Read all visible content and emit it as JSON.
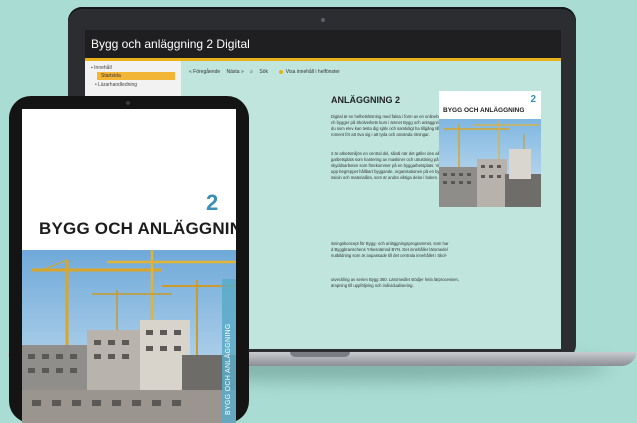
{
  "app": {
    "title": "Bygg och anläggning 2 Digital"
  },
  "sidebar": {
    "items": [
      {
        "label": "Innehåll"
      },
      {
        "label": "Startsida"
      },
      {
        "label": "• Lärarhandledning"
      }
    ]
  },
  "nav": {
    "prev": "« Föregående",
    "next": "Nästa »",
    "search": "Sök",
    "toc": "Visa innehåll i helfönster"
  },
  "document": {
    "title": "ANLÄGGNING 2",
    "paragraphs": [
      "Digital är en helhetslösning med fakta i form av en onlinebok\nch bygger på Skolverkets kurs i ämnet Bygg och anläggning.\ndu som elev kan testa dig själv och samtidigt ha tillgång till fakta från boken.\nroment för att öva sig i att tyda och använda ritningar.",
      "2 är arbetsmiljön en central del, såväl när det gäller den allmänna\ngarbetsplats som hantering av maskiner och utrustning på att\nskyddsarbeten som förekommer på en byggarbetsplats. Vidare tar\nupp begreppet hållbart byggande, organisationen på en bygg-\nssioin och materialåra, som är andra viktiga delar i boken.",
      "isningskoncept för Bygg- och anläggningsprogrammet, som har\nd Byggbranschens Yrkesnämnd BYN. Det innehåller läromedel\nnutbildning som är anpassade till det centrala innehållet i Skol-",
      "utveckling av serien Bygg 360. Läromedlet stödjer hela lärprocessen,\nämpning till uppföljning och individualisering."
    ]
  },
  "cover_small": {
    "number": "2",
    "title": "BYGG OCH ANLÄGGNING"
  },
  "tablet": {
    "number": "2",
    "title": "BYGG OCH ANLÄGGNING",
    "spine": "BYGG OCH ANLÄGGNING"
  },
  "colors": {
    "background": "#a9ddd3",
    "accent_yellow": "#e9b21b",
    "header_dark": "#1f1f22",
    "brand_blue": "#3b8fb7",
    "content_mint": "#bfe5dd"
  }
}
